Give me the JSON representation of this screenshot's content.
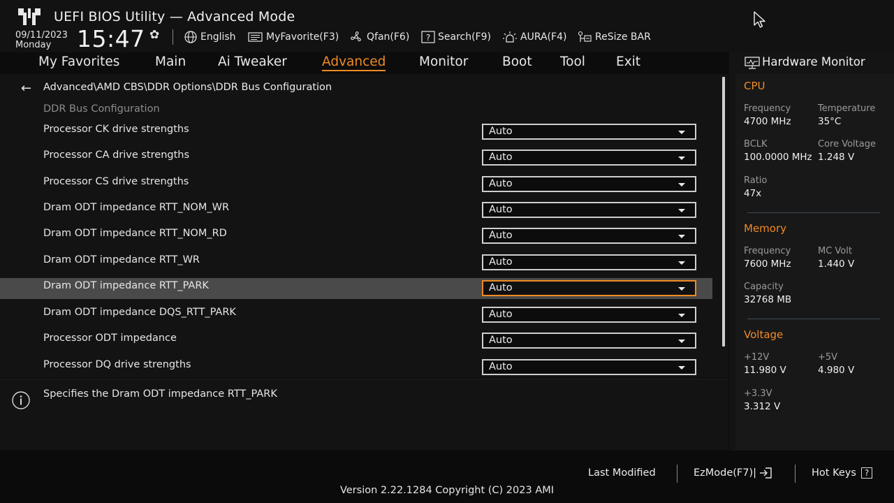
{
  "header": {
    "title": "UEFI BIOS Utility — Advanced Mode",
    "date": "09/11/2023",
    "day": "Monday",
    "time": "15:47",
    "tools": [
      {
        "label": "English",
        "icon": "globe-icon"
      },
      {
        "label": "MyFavorite(F3)",
        "icon": "favorite-icon"
      },
      {
        "label": "Qfan(F6)",
        "icon": "fan-icon"
      },
      {
        "label": "Search(F9)",
        "icon": "search-help-icon"
      },
      {
        "label": "AURA(F4)",
        "icon": "aura-icon"
      },
      {
        "label": "ReSize BAR",
        "icon": "resize-bar-icon"
      }
    ]
  },
  "menu": {
    "items": [
      "My Favorites",
      "Main",
      "Ai Tweaker",
      "Advanced",
      "Monitor",
      "Boot",
      "Tool",
      "Exit"
    ],
    "active": "Advanced"
  },
  "panel": {
    "breadcrumb": "Advanced\\AMD CBS\\DDR Options\\DDR Bus Configuration",
    "section_title": "DDR Bus Configuration",
    "rows": [
      {
        "label": "Processor CK drive strengths",
        "value": "Auto"
      },
      {
        "label": "Processor CA drive strengths",
        "value": "Auto"
      },
      {
        "label": "Processor CS drive strengths",
        "value": "Auto"
      },
      {
        "label": "Dram ODT impedance RTT_NOM_WR",
        "value": "Auto"
      },
      {
        "label": "Dram ODT impedance RTT_NOM_RD",
        "value": "Auto"
      },
      {
        "label": "Dram ODT impedance RTT_WR",
        "value": "Auto"
      },
      {
        "label": "Dram ODT impedance RTT_PARK",
        "value": "Auto"
      },
      {
        "label": "Dram ODT impedance DQS_RTT_PARK",
        "value": "Auto"
      },
      {
        "label": "Processor ODT impedance",
        "value": "Auto"
      },
      {
        "label": "Processor DQ drive strengths",
        "value": "Auto"
      }
    ],
    "selected_row": "Dram ODT impedance RTT_PARK"
  },
  "help": {
    "text": "Specifies the Dram ODT impedance RTT_PARK"
  },
  "hardware_monitor": {
    "title": "Hardware Monitor",
    "cpu": {
      "section": "CPU",
      "frequency_label": "Frequency",
      "frequency": "4700 MHz",
      "temperature_label": "Temperature",
      "temperature": "35°C",
      "bclk_label": "BCLK",
      "bclk": "100.0000 MHz",
      "core_voltage_label": "Core Voltage",
      "core_voltage": "1.248 V",
      "ratio_label": "Ratio",
      "ratio": "47x"
    },
    "memory": {
      "section": "Memory",
      "frequency_label": "Frequency",
      "frequency": "7600 MHz",
      "mc_volt_label": "MC Volt",
      "mc_volt": "1.440 V",
      "capacity_label": "Capacity",
      "capacity": "32768 MB"
    },
    "voltage": {
      "section": "Voltage",
      "v12_label": "+12V",
      "v12": "11.980 V",
      "v5_label": "+5V",
      "v5": "4.980 V",
      "v33_label": "+3.3V",
      "v33": "3.312 V"
    }
  },
  "footer": {
    "last_modified": "Last Modified",
    "ezmode": "EzMode(F7)|",
    "hotkeys": "Hot Keys",
    "hotkeys_key": "?",
    "version": "Version 2.22.1284 Copyright (C) 2023 AMI"
  },
  "colors": {
    "accent": "#f08a24",
    "background": "#0f0f0f",
    "selected_row": "#4a4a4a"
  }
}
